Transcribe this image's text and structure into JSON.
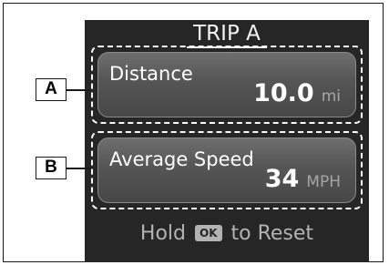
{
  "screen": {
    "title": "TRIP A"
  },
  "panels": [
    {
      "callout": "A",
      "label": "Distance",
      "value": "10.0",
      "unit": "mi"
    },
    {
      "callout": "B",
      "label": "Average Speed",
      "value": "34",
      "unit": "MPH"
    }
  ],
  "footer": {
    "prefix": "Hold",
    "button": "OK",
    "suffix": "to Reset"
  },
  "colors": {
    "screen_background": "#262626",
    "panel_fill": "#555555",
    "unit_text": "#a6a6a6",
    "footer_text": "#b3b3b3"
  }
}
